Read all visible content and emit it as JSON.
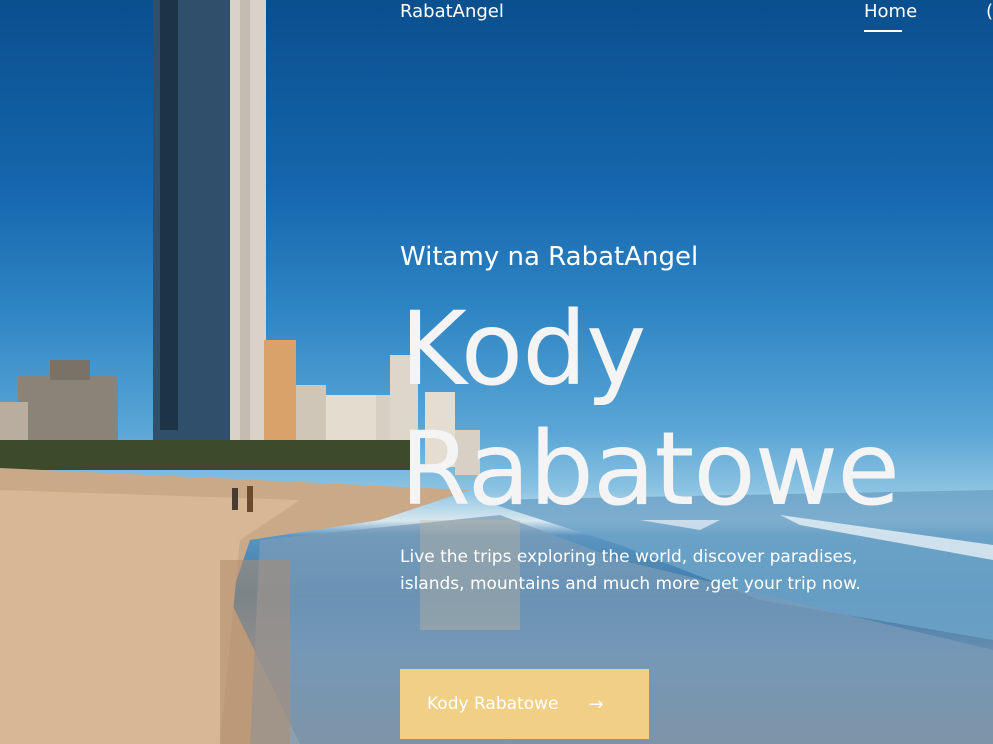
{
  "nav": {
    "brand": "RabatAngel",
    "home": "Home",
    "extra": "("
  },
  "hero": {
    "welcome": "Witamy na RabatAngel",
    "headline": "Kody Rabatowe",
    "lead": "Live the trips exploring the world, discover paradises, islands, mountains and much more ,get your trip now.",
    "cta_label": "Kody Rabatowe",
    "cta_icon": "arrow-right-icon"
  },
  "colors": {
    "accent": "#f2cf86",
    "text": "#ffffff"
  }
}
